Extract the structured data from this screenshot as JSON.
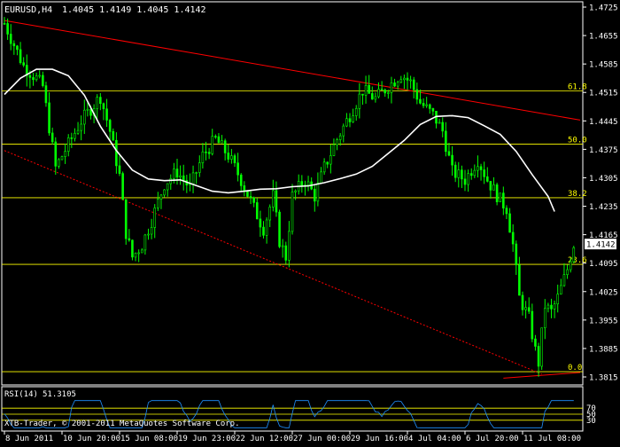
{
  "header": {
    "symbol": "EURUSD,H4",
    "ohlc": "1.4045 1.4149 1.4045 1.4142"
  },
  "rsi_header": {
    "label": "RSI(14)",
    "value": "51.3105"
  },
  "copyright": "XTB-Trader, © 2001-2011 MetaQuotes Software Corp.",
  "colors": {
    "background": "#000000",
    "frame": "#ffffff",
    "candle": "#00ff00",
    "moving_average": "#ffffff",
    "fib_lines": "#ffff00",
    "fib_labels": "#ffff00",
    "trendline": "#ff0000",
    "rsi_line": "#1e90ff",
    "rsi_levels": "#ffff00",
    "price_tag_bg": "#ffffff",
    "price_tag_text": "#000000"
  },
  "chart_data": {
    "type": "candlestick",
    "title": "EURUSD,H4",
    "current_price": "1.4142",
    "ylim": [
      1.3815,
      1.4725
    ],
    "y_ticks": [
      "1.4725",
      "1.4655",
      "1.4585",
      "1.4515",
      "1.4445",
      "1.4375",
      "1.4305",
      "1.4235",
      "1.4165",
      "1.4095",
      "1.4025",
      "1.3955",
      "1.3885",
      "1.3815"
    ],
    "x_ticks": [
      "8 Jun 2011",
      "10 Jun 20:00",
      "15 Jun 08:00",
      "19 Jun 23:00",
      "22 Jun 12:00",
      "27 Jun 00:00",
      "29 Jun 16:00",
      "4 Jul 04:00",
      "6 Jul 20:00",
      "11 Jul 08:00"
    ],
    "fib_levels": [
      {
        "label": "61.8",
        "price": 1.4519
      },
      {
        "label": "50.0",
        "price": 1.4388
      },
      {
        "label": "38.2",
        "price": 1.4256
      },
      {
        "label": "23.6",
        "price": 1.4092
      },
      {
        "label": "0.0",
        "price": 1.3828
      }
    ],
    "trendlines": [
      {
        "style": "solid",
        "from": [
          0,
          1.4692
        ],
        "to": [
          180,
          1.4447
        ]
      },
      {
        "style": "dashed",
        "from": [
          0,
          1.4372
        ],
        "to": [
          168,
          1.3822
        ]
      },
      {
        "style": "solid",
        "from": [
          156,
          1.3812
        ],
        "to": [
          180,
          1.3826
        ]
      }
    ],
    "ma_points": [
      [
        0,
        1.451
      ],
      [
        5,
        1.455
      ],
      [
        10,
        1.4572
      ],
      [
        15,
        1.4572
      ],
      [
        20,
        1.4556
      ],
      [
        25,
        1.4508
      ],
      [
        30,
        1.4432
      ],
      [
        35,
        1.4372
      ],
      [
        40,
        1.4324
      ],
      [
        45,
        1.4302
      ],
      [
        50,
        1.4298
      ],
      [
        55,
        1.43
      ],
      [
        60,
        1.4286
      ],
      [
        65,
        1.4272
      ],
      [
        70,
        1.4268
      ],
      [
        75,
        1.4272
      ],
      [
        80,
        1.4277
      ],
      [
        85,
        1.4278
      ],
      [
        90,
        1.4283
      ],
      [
        95,
        1.4285
      ],
      [
        100,
        1.4293
      ],
      [
        105,
        1.4303
      ],
      [
        110,
        1.4314
      ],
      [
        115,
        1.4333
      ],
      [
        120,
        1.4365
      ],
      [
        125,
        1.4397
      ],
      [
        130,
        1.4436
      ],
      [
        135,
        1.4456
      ],
      [
        140,
        1.4458
      ],
      [
        145,
        1.4453
      ],
      [
        150,
        1.4433
      ],
      [
        155,
        1.4412
      ],
      [
        160,
        1.437
      ],
      [
        165,
        1.4313
      ],
      [
        170,
        1.4259
      ],
      [
        172,
        1.4222
      ]
    ],
    "close_path": [
      [
        0,
        1.4685
      ],
      [
        6,
        1.458
      ],
      [
        10,
        1.455
      ],
      [
        12,
        1.453
      ],
      [
        16,
        1.433
      ],
      [
        24,
        1.4445
      ],
      [
        30,
        1.4505
      ],
      [
        33,
        1.442
      ],
      [
        36,
        1.431
      ],
      [
        38,
        1.417
      ],
      [
        40,
        1.411
      ],
      [
        43,
        1.414
      ],
      [
        46,
        1.42
      ],
      [
        50,
        1.429
      ],
      [
        54,
        1.432
      ],
      [
        58,
        1.428
      ],
      [
        62,
        1.436
      ],
      [
        66,
        1.44
      ],
      [
        70,
        1.436
      ],
      [
        74,
        1.43
      ],
      [
        78,
        1.423
      ],
      [
        81,
        1.418
      ],
      [
        84,
        1.426
      ],
      [
        86,
        1.415
      ],
      [
        88,
        1.411
      ],
      [
        90,
        1.426
      ],
      [
        94,
        1.43
      ],
      [
        97,
        1.426
      ],
      [
        100,
        1.433
      ],
      [
        104,
        1.44
      ],
      [
        108,
        1.446
      ],
      [
        112,
        1.452
      ],
      [
        116,
        1.45
      ],
      [
        120,
        1.453
      ],
      [
        124,
        1.456
      ],
      [
        127,
        1.454
      ],
      [
        130,
        1.449
      ],
      [
        134,
        1.446
      ],
      [
        137,
        1.442
      ],
      [
        140,
        1.432
      ],
      [
        144,
        1.43
      ],
      [
        148,
        1.435
      ],
      [
        151,
        1.43
      ],
      [
        155,
        1.425
      ],
      [
        157,
        1.423
      ],
      [
        159,
        1.414
      ],
      [
        161,
        1.401
      ],
      [
        164,
        1.396
      ],
      [
        166,
        1.388
      ],
      [
        167,
        1.385
      ],
      [
        169,
        1.399
      ],
      [
        171,
        1.3975
      ],
      [
        173,
        1.401
      ],
      [
        176,
        1.408
      ],
      [
        178,
        1.4142
      ]
    ],
    "rsi": {
      "ylim": [
        0,
        100
      ],
      "levels": [
        {
          "label": "70",
          "value": 70
        },
        {
          "label": "50",
          "value": 50
        },
        {
          "label": "30",
          "value": 30
        }
      ],
      "current": 51.3105
    }
  }
}
